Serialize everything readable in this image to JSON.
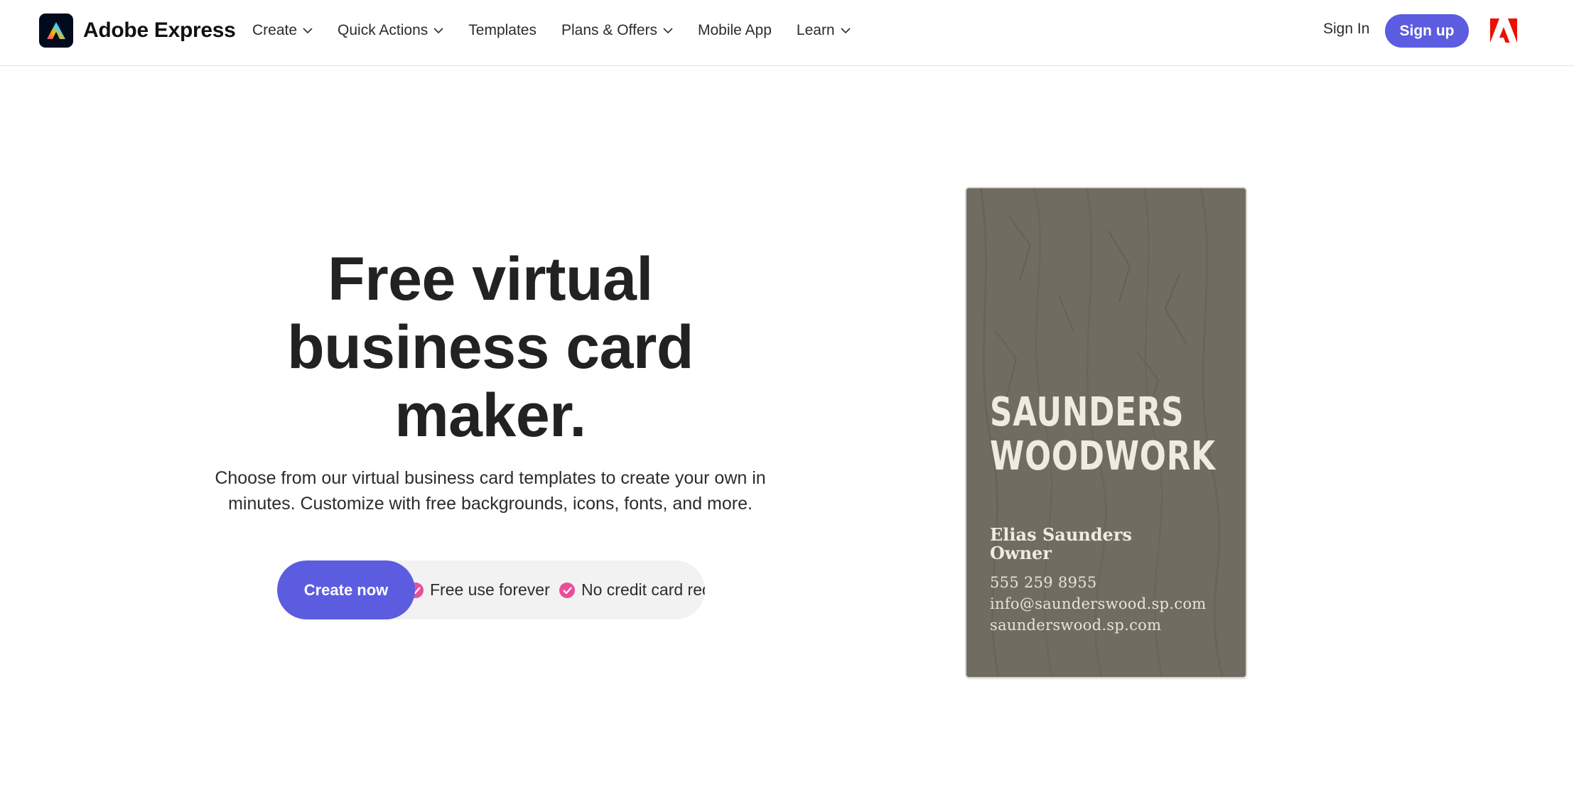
{
  "header": {
    "brand": "Adobe Express",
    "nav": [
      {
        "label": "Create",
        "has_dropdown": true
      },
      {
        "label": "Quick Actions",
        "has_dropdown": true
      },
      {
        "label": "Templates",
        "has_dropdown": false
      },
      {
        "label": "Plans & Offers",
        "has_dropdown": true
      },
      {
        "label": "Mobile App",
        "has_dropdown": false
      },
      {
        "label": "Learn",
        "has_dropdown": true
      }
    ],
    "sign_in": "Sign In",
    "sign_up": "Sign up"
  },
  "hero": {
    "title_lines": [
      "Free virtual",
      "business card",
      "maker."
    ],
    "subtitle_lines": [
      "Choose from our virtual business card templates to create your own in",
      "minutes. Customize with free backgrounds, icons, fonts, and more."
    ],
    "cta": "Create now",
    "perks": [
      "Free use forever",
      "No credit card req"
    ]
  },
  "card": {
    "company_lines": [
      "SAUNDERS",
      "WOODWORK"
    ],
    "name": "Elias Saunders",
    "role": "Owner",
    "phone": "555 259 8955",
    "email": "info@saunderswood.sp.com",
    "website": "saunderswood.sp.com"
  },
  "colors": {
    "accent": "#5c5ce0",
    "check": "#e94e9c",
    "card_bg": "#6f6a5f",
    "adobe_red": "#eb1000"
  },
  "icons": {
    "logo": "adobe-express-logo-icon",
    "dropdown": "chevron-down-icon",
    "corporate": "adobe-logo-icon",
    "perk": "check-circle-icon"
  }
}
